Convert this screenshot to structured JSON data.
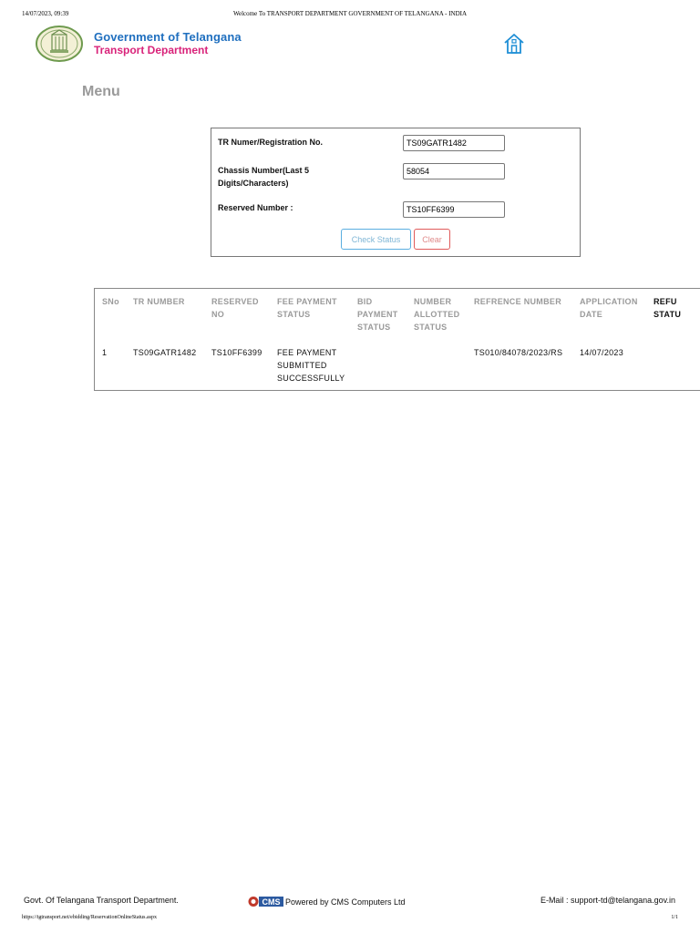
{
  "print_header": {
    "timestamp": "14/07/2023, 09:39",
    "title": "Welcome To TRANSPORT DEPARTMENT GOVERNMENT OF TELANGANA - INDIA"
  },
  "header": {
    "brand_line1": "Government of Telangana",
    "brand_line2": "Transport Department",
    "logo_icon": "telangana-emblem-icon",
    "home_icon": "home-icon",
    "colors": {
      "brand_blue": "#1f6fbf",
      "brand_pink": "#d9237a"
    }
  },
  "menu": {
    "title": "Menu"
  },
  "form": {
    "tr_label": "TR Numer/Registration No.",
    "tr_value": "TS09GATR1482",
    "chassis_label_line1": "Chassis Number(Last 5",
    "chassis_label_line2": "Digits/Characters)",
    "chassis_value": "58054",
    "reserved_label": "Reserved Number :",
    "reserved_value": "TS10FF6399",
    "check_status_label": "Check Status",
    "clear_label": "Clear"
  },
  "table": {
    "headers": [
      [
        "SNo"
      ],
      [
        "TR NUMBER"
      ],
      [
        "RESERVED",
        "NO"
      ],
      [
        "FEE PAYMENT",
        "STATUS"
      ],
      [
        "BID",
        "PAYMENT",
        "STATUS"
      ],
      [
        "NUMBER",
        "ALLOTTED",
        "STATUS"
      ],
      [
        "REFRENCE NUMBER"
      ],
      [
        "APPLICATION",
        "DATE"
      ],
      [
        "REFU",
        "STATU"
      ]
    ],
    "rows": [
      {
        "sno": "1",
        "tr_number": "TS09GATR1482",
        "reserved_no": "TS10FF6399",
        "fee_status_line1": "FEE PAYMENT",
        "fee_status_line2": "SUBMITTED",
        "fee_status_line3": "SUCCESSFULLY",
        "bid_status": "",
        "allotted_status": "",
        "reference_number": "TS010/84078/2023/RS",
        "application_date": "14/07/2023"
      }
    ]
  },
  "footer": {
    "left": "Govt. Of Telangana Transport Department.",
    "cms_logo_icon": "cms-logo-icon",
    "cms_logo_text": "CMS",
    "mid": "Powered by CMS Computers Ltd",
    "right": "E-Mail : support-td@telangana.gov.in"
  },
  "print_footer": {
    "url": "https://tgtransport.net/ebidding/ReservationOnlineStatus.aspx",
    "page": "1/1"
  }
}
